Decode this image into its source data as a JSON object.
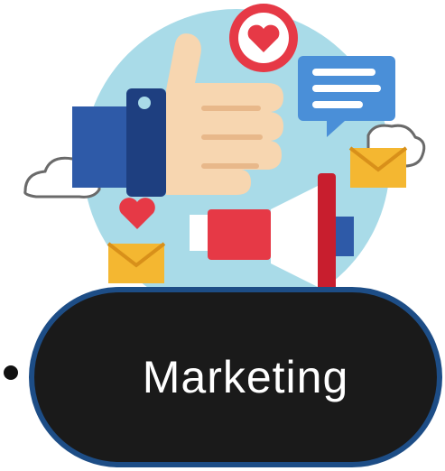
{
  "badge": {
    "label": "Marketing"
  },
  "icons": [
    "thumbs-up-icon",
    "heart-icon",
    "chat-bubble-icon",
    "envelope-icon",
    "megaphone-icon",
    "cloud-icon"
  ],
  "colors": {
    "pill_bg": "#1a1a1a",
    "pill_border": "#1d4d86",
    "circle": "#a9dbe8"
  }
}
